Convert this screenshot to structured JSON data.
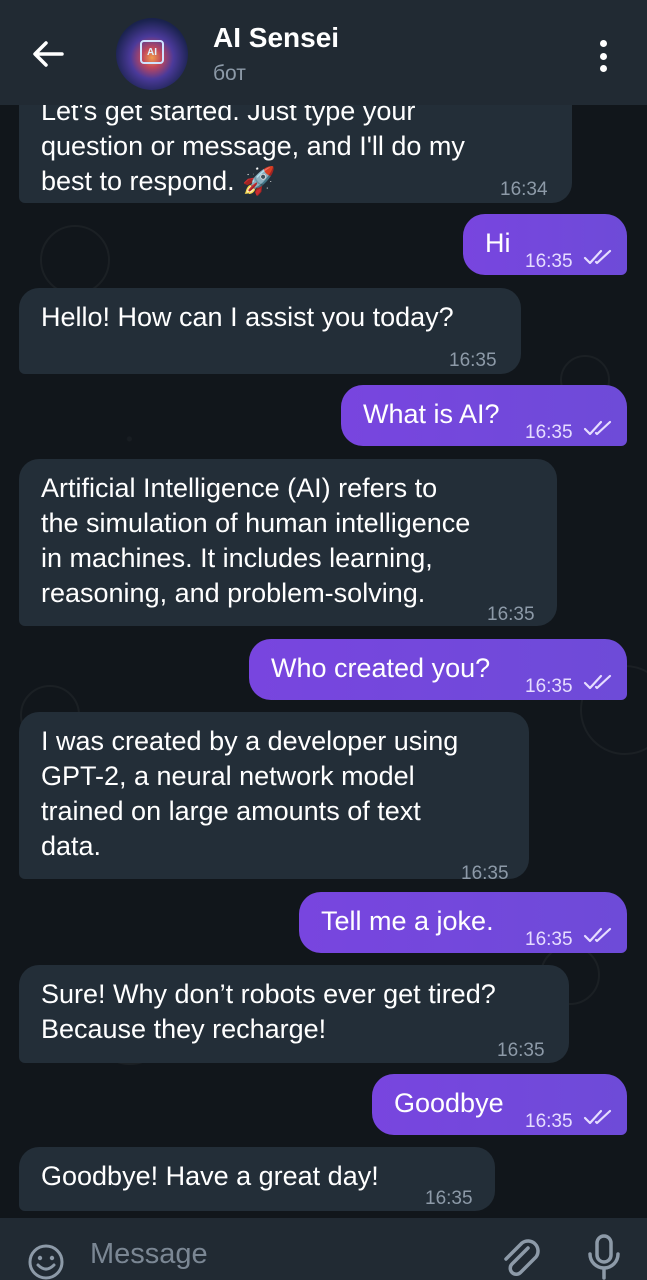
{
  "header": {
    "title": "AI Sensei",
    "subtitle": "бот",
    "avatar_text": "AI"
  },
  "messages": [
    {
      "id": "m0",
      "side": "in",
      "lines": [
        "Let's get started. Just type your",
        "question or message, and I'll do my",
        "best to respond. 🚀"
      ],
      "time": "16:34"
    },
    {
      "id": "m1",
      "side": "out",
      "lines": [
        "Hi"
      ],
      "time": "16:35"
    },
    {
      "id": "m2",
      "side": "in",
      "lines": [
        "Hello! How can I assist you today?"
      ],
      "time": "16:35"
    },
    {
      "id": "m3",
      "side": "out",
      "lines": [
        "What is AI?"
      ],
      "time": "16:35"
    },
    {
      "id": "m4",
      "side": "in",
      "lines": [
        "Artificial Intelligence (AI) refers to",
        "the simulation of human intelligence",
        "in machines. It includes learning,",
        "reasoning, and problem-solving."
      ],
      "time": "16:35"
    },
    {
      "id": "m5",
      "side": "out",
      "lines": [
        "Who created you?"
      ],
      "time": "16:35"
    },
    {
      "id": "m6",
      "side": "in",
      "lines": [
        "I was created by a developer using",
        "GPT-2, a neural network model",
        "trained on large amounts of text",
        "data."
      ],
      "time": "16:35"
    },
    {
      "id": "m7",
      "side": "out",
      "lines": [
        "Tell me a joke."
      ],
      "time": "16:35"
    },
    {
      "id": "m8",
      "side": "in",
      "lines": [
        "Sure! Why don’t robots ever get tired?",
        "Because they recharge!"
      ],
      "time": "16:35"
    },
    {
      "id": "m9",
      "side": "out",
      "lines": [
        "Goodbye"
      ],
      "time": "16:35"
    },
    {
      "id": "m10",
      "side": "in",
      "lines": [
        "Goodbye! Have a great day!"
      ],
      "time": "16:35"
    }
  ],
  "input": {
    "placeholder": "Message"
  },
  "icons": {
    "back": "arrow-left-icon",
    "menu": "more-vertical-icon",
    "emoji": "smile-icon",
    "attach": "paperclip-icon",
    "mic": "microphone-icon",
    "read": "double-check-icon"
  },
  "colors": {
    "header_bg": "#212a33",
    "chat_bg": "#11161b",
    "incoming_bubble": "#232e38",
    "outgoing_bubble": "#7845df",
    "muted_text": "#8d9aa8"
  }
}
